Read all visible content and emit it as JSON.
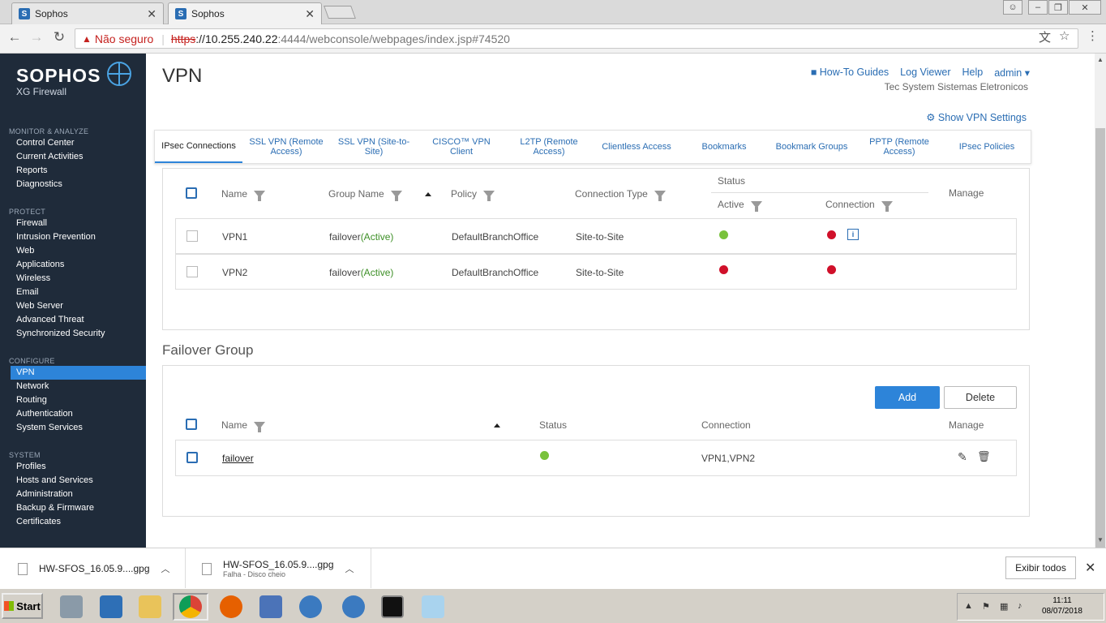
{
  "browser": {
    "tabs": [
      {
        "title": "Sophos",
        "favicon": "S"
      },
      {
        "title": "Sophos",
        "favicon": "S"
      }
    ],
    "security": "Não seguro",
    "url_scheme": "https",
    "url_host": "://10.255.240.22",
    "url_path": ":4444/webconsole/webpages/index.jsp#74520"
  },
  "sidebar": {
    "brand": "SOPHOS",
    "product": "XG Firewall",
    "sections": [
      {
        "title": "MONITOR & ANALYZE",
        "items": [
          "Control Center",
          "Current Activities",
          "Reports",
          "Diagnostics"
        ]
      },
      {
        "title": "PROTECT",
        "items": [
          "Firewall",
          "Intrusion Prevention",
          "Web",
          "Applications",
          "Wireless",
          "Email",
          "Web Server",
          "Advanced Threat",
          "Synchronized Security"
        ]
      },
      {
        "title": "CONFIGURE",
        "items": [
          "VPN",
          "Network",
          "Routing",
          "Authentication",
          "System Services"
        ]
      },
      {
        "title": "SYSTEM",
        "items": [
          "Profiles",
          "Hosts and Services",
          "Administration",
          "Backup & Firmware",
          "Certificates"
        ]
      }
    ],
    "active": "VPN"
  },
  "header": {
    "title": "VPN",
    "links": [
      "How-To Guides",
      "Log Viewer",
      "Help",
      "admin"
    ],
    "company": "Tec System Sistemas Eletronicos",
    "vpn_settings": "Show VPN Settings"
  },
  "tabs": [
    "IPsec Connections",
    "SSL VPN (Remote Access)",
    "SSL VPN (Site-to-Site)",
    "CISCO™ VPN Client",
    "L2TP (Remote Access)",
    "Clientless Access",
    "Bookmarks",
    "Bookmark Groups",
    "PPTP (Remote Access)",
    "IPsec Policies"
  ],
  "ipsec": {
    "headers": {
      "name": "Name",
      "group": "Group Name",
      "policy": "Policy",
      "conn_type": "Connection Type",
      "status": "Status",
      "active": "Active",
      "connection": "Connection",
      "manage": "Manage"
    },
    "rows": [
      {
        "name": "VPN1",
        "group": "failover",
        "group_state": "(Active)",
        "policy": "DefaultBranchOffice",
        "type": "Site-to-Site",
        "active": "green",
        "connection": "red"
      },
      {
        "name": "VPN2",
        "group": "failover",
        "group_state": "(Active)",
        "policy": "DefaultBranchOffice",
        "type": "Site-to-Site",
        "active": "red",
        "connection": "red"
      }
    ]
  },
  "failover": {
    "title": "Failover Group",
    "add": "Add",
    "delete": "Delete",
    "headers": {
      "name": "Name",
      "status": "Status",
      "connection": "Connection",
      "manage": "Manage"
    },
    "rows": [
      {
        "name": "failover",
        "status": "green",
        "connection": "VPN1,VPN2"
      }
    ]
  },
  "downloads": {
    "items": [
      {
        "name": "HW-SFOS_16.05.9....gpg",
        "status": ""
      },
      {
        "name": "HW-SFOS_16.05.9....gpg",
        "status": "Falha - Disco cheio"
      }
    ],
    "show_all": "Exibir todos"
  },
  "taskbar": {
    "start": "Start",
    "time": "11:11",
    "date": "08/07/2018"
  },
  "colors": {
    "accent": "#2d84d9",
    "sidebar": "#1f2b3a",
    "ok": "#79c23c",
    "fail": "#d0102a"
  }
}
